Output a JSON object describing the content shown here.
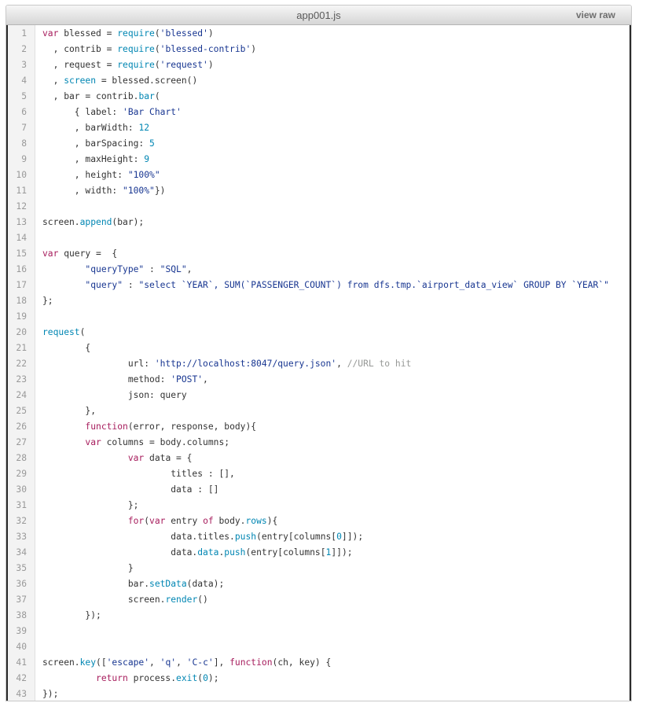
{
  "header": {
    "filename": "app001.js",
    "view_raw_label": "view raw"
  },
  "colors": {
    "keyword": "#a71d5d",
    "function": "#0086b3",
    "string": "#183691",
    "number": "#0086b3",
    "comment": "#969896",
    "text": "#333333"
  },
  "code_lines": [
    {
      "n": "1",
      "tokens": [
        {
          "t": "kw",
          "v": "var"
        },
        {
          "t": "txt",
          "v": " blessed = "
        },
        {
          "t": "fn",
          "v": "require"
        },
        {
          "t": "txt",
          "v": "("
        },
        {
          "t": "str",
          "v": "'blessed'"
        },
        {
          "t": "txt",
          "v": ")"
        }
      ]
    },
    {
      "n": "2",
      "tokens": [
        {
          "t": "txt",
          "v": "  , contrib = "
        },
        {
          "t": "fn",
          "v": "require"
        },
        {
          "t": "txt",
          "v": "("
        },
        {
          "t": "str",
          "v": "'blessed-contrib'"
        },
        {
          "t": "txt",
          "v": ")"
        }
      ]
    },
    {
      "n": "3",
      "tokens": [
        {
          "t": "txt",
          "v": "  , request = "
        },
        {
          "t": "fn",
          "v": "require"
        },
        {
          "t": "txt",
          "v": "("
        },
        {
          "t": "str",
          "v": "'request'"
        },
        {
          "t": "txt",
          "v": ")"
        }
      ]
    },
    {
      "n": "4",
      "tokens": [
        {
          "t": "txt",
          "v": "  , "
        },
        {
          "t": "fn",
          "v": "screen"
        },
        {
          "t": "txt",
          "v": " = blessed.screen()"
        }
      ]
    },
    {
      "n": "5",
      "tokens": [
        {
          "t": "txt",
          "v": "  , bar = contrib."
        },
        {
          "t": "fn",
          "v": "bar"
        },
        {
          "t": "txt",
          "v": "("
        }
      ]
    },
    {
      "n": "6",
      "tokens": [
        {
          "t": "txt",
          "v": "      { label: "
        },
        {
          "t": "str",
          "v": "'Bar Chart'"
        }
      ]
    },
    {
      "n": "7",
      "tokens": [
        {
          "t": "txt",
          "v": "      , barWidth: "
        },
        {
          "t": "num",
          "v": "12"
        }
      ]
    },
    {
      "n": "8",
      "tokens": [
        {
          "t": "txt",
          "v": "      , barSpacing: "
        },
        {
          "t": "num",
          "v": "5"
        }
      ]
    },
    {
      "n": "9",
      "tokens": [
        {
          "t": "txt",
          "v": "      , maxHeight: "
        },
        {
          "t": "num",
          "v": "9"
        }
      ]
    },
    {
      "n": "10",
      "tokens": [
        {
          "t": "txt",
          "v": "      , height: "
        },
        {
          "t": "str",
          "v": "\"100%\""
        }
      ]
    },
    {
      "n": "11",
      "tokens": [
        {
          "t": "txt",
          "v": "      , width: "
        },
        {
          "t": "str",
          "v": "\"100%\""
        },
        {
          "t": "txt",
          "v": "})"
        }
      ]
    },
    {
      "n": "12",
      "tokens": []
    },
    {
      "n": "13",
      "tokens": [
        {
          "t": "txt",
          "v": "screen."
        },
        {
          "t": "fn",
          "v": "append"
        },
        {
          "t": "txt",
          "v": "(bar);"
        }
      ]
    },
    {
      "n": "14",
      "tokens": []
    },
    {
      "n": "15",
      "tokens": [
        {
          "t": "kw",
          "v": "var"
        },
        {
          "t": "txt",
          "v": " query =  {"
        }
      ]
    },
    {
      "n": "16",
      "tokens": [
        {
          "t": "txt",
          "v": "        "
        },
        {
          "t": "str",
          "v": "\"queryType\""
        },
        {
          "t": "txt",
          "v": " : "
        },
        {
          "t": "str",
          "v": "\"SQL\""
        },
        {
          "t": "txt",
          "v": ","
        }
      ]
    },
    {
      "n": "17",
      "tokens": [
        {
          "t": "txt",
          "v": "        "
        },
        {
          "t": "str",
          "v": "\"query\""
        },
        {
          "t": "txt",
          "v": " : "
        },
        {
          "t": "str",
          "v": "\"select `YEAR`, SUM(`PASSENGER_COUNT`) from dfs.tmp.`airport_data_view` GROUP BY `YEAR`\""
        }
      ]
    },
    {
      "n": "18",
      "tokens": [
        {
          "t": "txt",
          "v": "};"
        }
      ]
    },
    {
      "n": "19",
      "tokens": []
    },
    {
      "n": "20",
      "tokens": [
        {
          "t": "fn",
          "v": "request"
        },
        {
          "t": "txt",
          "v": "("
        }
      ]
    },
    {
      "n": "21",
      "tokens": [
        {
          "t": "txt",
          "v": "        {"
        }
      ]
    },
    {
      "n": "22",
      "tokens": [
        {
          "t": "txt",
          "v": "                url: "
        },
        {
          "t": "str",
          "v": "'http://localhost:8047/query.json'"
        },
        {
          "t": "txt",
          "v": ", "
        },
        {
          "t": "com",
          "v": "//URL to hit"
        }
      ]
    },
    {
      "n": "23",
      "tokens": [
        {
          "t": "txt",
          "v": "                method: "
        },
        {
          "t": "str",
          "v": "'POST'"
        },
        {
          "t": "txt",
          "v": ","
        }
      ]
    },
    {
      "n": "24",
      "tokens": [
        {
          "t": "txt",
          "v": "                json: query"
        }
      ]
    },
    {
      "n": "25",
      "tokens": [
        {
          "t": "txt",
          "v": "        },"
        }
      ]
    },
    {
      "n": "26",
      "tokens": [
        {
          "t": "txt",
          "v": "        "
        },
        {
          "t": "kw",
          "v": "function"
        },
        {
          "t": "txt",
          "v": "(error, response, body){"
        }
      ]
    },
    {
      "n": "27",
      "tokens": [
        {
          "t": "txt",
          "v": "        "
        },
        {
          "t": "kw",
          "v": "var"
        },
        {
          "t": "txt",
          "v": " columns = body.columns;"
        }
      ]
    },
    {
      "n": "28",
      "tokens": [
        {
          "t": "txt",
          "v": "                "
        },
        {
          "t": "kw",
          "v": "var"
        },
        {
          "t": "txt",
          "v": " data = {"
        }
      ]
    },
    {
      "n": "29",
      "tokens": [
        {
          "t": "txt",
          "v": "                        titles : [],"
        }
      ]
    },
    {
      "n": "30",
      "tokens": [
        {
          "t": "txt",
          "v": "                        data : []"
        }
      ]
    },
    {
      "n": "31",
      "tokens": [
        {
          "t": "txt",
          "v": "                };"
        }
      ]
    },
    {
      "n": "32",
      "tokens": [
        {
          "t": "txt",
          "v": "                "
        },
        {
          "t": "kw",
          "v": "for"
        },
        {
          "t": "txt",
          "v": "("
        },
        {
          "t": "kw",
          "v": "var"
        },
        {
          "t": "txt",
          "v": " entry "
        },
        {
          "t": "kw",
          "v": "of"
        },
        {
          "t": "txt",
          "v": " body."
        },
        {
          "t": "fn",
          "v": "rows"
        },
        {
          "t": "txt",
          "v": "){"
        }
      ]
    },
    {
      "n": "33",
      "tokens": [
        {
          "t": "txt",
          "v": "                        data.titles."
        },
        {
          "t": "fn",
          "v": "push"
        },
        {
          "t": "txt",
          "v": "(entry[columns["
        },
        {
          "t": "num",
          "v": "0"
        },
        {
          "t": "txt",
          "v": "]]);"
        }
      ]
    },
    {
      "n": "34",
      "tokens": [
        {
          "t": "txt",
          "v": "                        data."
        },
        {
          "t": "fn",
          "v": "data"
        },
        {
          "t": "txt",
          "v": "."
        },
        {
          "t": "fn",
          "v": "push"
        },
        {
          "t": "txt",
          "v": "(entry[columns["
        },
        {
          "t": "num",
          "v": "1"
        },
        {
          "t": "txt",
          "v": "]]);"
        }
      ]
    },
    {
      "n": "35",
      "tokens": [
        {
          "t": "txt",
          "v": "                }"
        }
      ]
    },
    {
      "n": "36",
      "tokens": [
        {
          "t": "txt",
          "v": "                bar."
        },
        {
          "t": "fn",
          "v": "setData"
        },
        {
          "t": "txt",
          "v": "(data);"
        }
      ]
    },
    {
      "n": "37",
      "tokens": [
        {
          "t": "txt",
          "v": "                screen."
        },
        {
          "t": "fn",
          "v": "render"
        },
        {
          "t": "txt",
          "v": "()"
        }
      ]
    },
    {
      "n": "38",
      "tokens": [
        {
          "t": "txt",
          "v": "        });"
        }
      ]
    },
    {
      "n": "39",
      "tokens": []
    },
    {
      "n": "40",
      "tokens": []
    },
    {
      "n": "41",
      "tokens": [
        {
          "t": "txt",
          "v": "screen."
        },
        {
          "t": "fn",
          "v": "key"
        },
        {
          "t": "txt",
          "v": "(["
        },
        {
          "t": "str",
          "v": "'escape'"
        },
        {
          "t": "txt",
          "v": ", "
        },
        {
          "t": "str",
          "v": "'q'"
        },
        {
          "t": "txt",
          "v": ", "
        },
        {
          "t": "str",
          "v": "'C-c'"
        },
        {
          "t": "txt",
          "v": "], "
        },
        {
          "t": "kw",
          "v": "function"
        },
        {
          "t": "txt",
          "v": "(ch, key) {"
        }
      ]
    },
    {
      "n": "42",
      "tokens": [
        {
          "t": "txt",
          "v": "          "
        },
        {
          "t": "kw",
          "v": "return"
        },
        {
          "t": "txt",
          "v": " process."
        },
        {
          "t": "fn",
          "v": "exit"
        },
        {
          "t": "txt",
          "v": "("
        },
        {
          "t": "num",
          "v": "0"
        },
        {
          "t": "txt",
          "v": ");"
        }
      ]
    },
    {
      "n": "43",
      "tokens": [
        {
          "t": "txt",
          "v": "});"
        }
      ]
    }
  ]
}
